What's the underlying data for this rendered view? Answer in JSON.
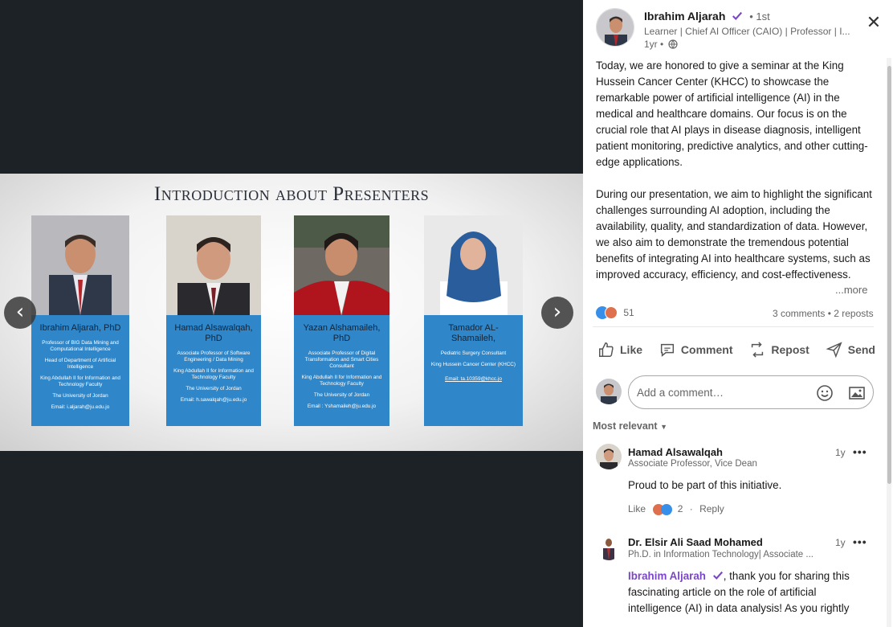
{
  "slide": {
    "title": "Introduction about Presenters",
    "presenters": [
      {
        "name": "Ibrahim Aljarah, PhD",
        "lines": [
          "Professor of BIG Data Mining and Computational Intelligence",
          "Head of Department of Artificial Intelligence",
          "King Abdullah II for Information and Technology Faculty",
          "The University of Jordan",
          "Email: i.aljarah@ju.edu.jo"
        ]
      },
      {
        "name": "Hamad Alsawalqah, PhD",
        "lines": [
          "Associate Professor of Software Engineering / Data Mining",
          "King Abdullah II for Information and Technology Faculty",
          "The University of Jordan",
          "Email: h.sawalqah@ju.edu.jo"
        ]
      },
      {
        "name": "Yazan Alshamaileh, PhD",
        "lines": [
          "Associate Professor of Digital Transformation and Smart Cities Consultant",
          "King Abdullah II for Information and Technology Faculty",
          "The University of Jordan",
          "Email : Yshamaileh@ju.edu.jo"
        ]
      },
      {
        "name": "Tamador AL-Shamaileh,",
        "lines": [
          "Pediatric Surgery Consultant",
          "King Hussein Cancer Center (KHCC)",
          "Email: ta.10359@khcc.jo"
        ]
      }
    ]
  },
  "viewer": {
    "prev_icon": "chevron-left-icon",
    "next_icon": "chevron-right-icon"
  },
  "post": {
    "author": "Ibrahim Aljarah",
    "degree": "• 1st",
    "headline": "Learner | Chief AI Officer (CAIO) | Professor | I...",
    "time": "1yr •",
    "paragraph1": "Today, we are honored to give a seminar at the King Hussein Cancer Center (KHCC) to showcase the remarkable power of artificial intelligence (AI) in the medical and healthcare domains. Our focus is on the crucial role that AI plays in disease diagnosis, intelligent patient monitoring, predictive analytics, and other cutting-edge applications.",
    "paragraph2": "During our presentation, we aim to highlight the significant challenges surrounding AI adoption, including the availability, quality, and standardization of data. However, we also aim to demonstrate the tremendous potential benefits of integrating AI into healthcare systems, such as improved accuracy, efficiency, and cost-effectiveness.",
    "more": "...more",
    "reactions_count": "51",
    "stats": "3 comments • 2 reposts"
  },
  "actions": {
    "like": "Like",
    "comment": "Comment",
    "repost": "Repost",
    "send": "Send"
  },
  "comment_box": {
    "placeholder": "Add a comment…"
  },
  "sort": {
    "label": "Most relevant"
  },
  "comments": [
    {
      "name": "Hamad Alsawalqah",
      "headline": "Associate Professor, Vice Dean",
      "time": "1y",
      "body": "Proud to be part of this initiative.",
      "like": "Like",
      "reaction_count": "2",
      "reply": "Reply"
    },
    {
      "name": "Dr. Elsir Ali Saad Mohamed",
      "headline": "Ph.D. in Information Technology| Associate ...",
      "time": "1y",
      "mention": "Ibrahim Aljarah",
      "body": ", thank you for sharing this fascinating article on the role of artificial intelligence (AI) in data analysis! As you rightly"
    }
  ],
  "colors": {
    "accent": "#0a66c2",
    "slide_card": "#2f86c8",
    "mention": "#7b47c6"
  }
}
